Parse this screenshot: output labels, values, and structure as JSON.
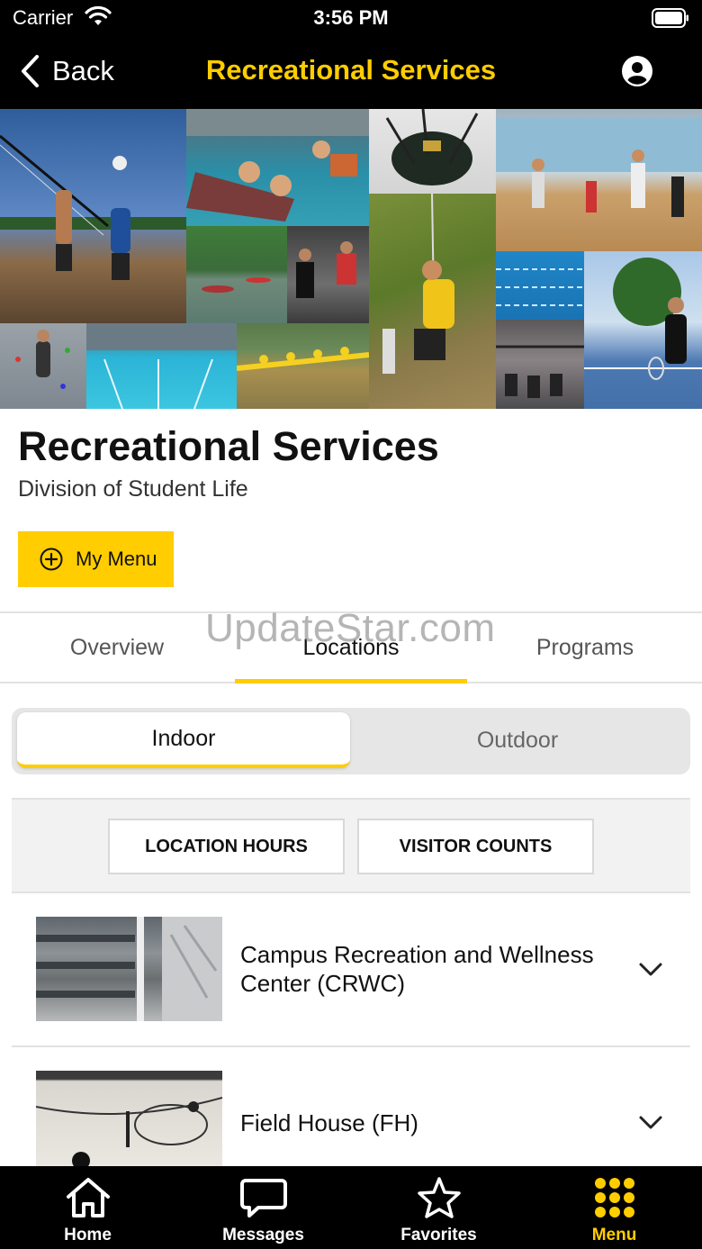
{
  "status_bar": {
    "carrier": "Carrier",
    "time": "3:56 PM"
  },
  "nav": {
    "back_label": "Back",
    "title": "Recreational Services",
    "profile_icon": "account-circle-icon"
  },
  "header": {
    "title": "Recreational Services",
    "subtitle": "Division of Student Life",
    "my_menu_label": "My Menu"
  },
  "tabs": [
    {
      "label": "Overview",
      "active": false
    },
    {
      "label": "Locations",
      "active": true
    },
    {
      "label": "Programs",
      "active": false
    }
  ],
  "watermark": "UpdateStar.com",
  "segment": {
    "options": [
      "Indoor",
      "Outdoor"
    ],
    "selected": "Indoor"
  },
  "actions": {
    "location_hours": "LOCATION HOURS",
    "visitor_counts": "VISITOR COUNTS"
  },
  "locations": [
    {
      "name": "Campus Recreation and Wellness Center (CRWC)"
    },
    {
      "name": "Field House (FH)"
    }
  ],
  "tab_bar": [
    {
      "label": "Home",
      "icon": "home-icon",
      "active": false
    },
    {
      "label": "Messages",
      "icon": "chat-bubble-icon",
      "active": false
    },
    {
      "label": "Favorites",
      "icon": "star-icon",
      "active": false
    },
    {
      "label": "Menu",
      "icon": "grid-menu-icon",
      "active": true
    }
  ],
  "colors": {
    "accent": "#ffcd00",
    "bar_background": "#000000"
  }
}
